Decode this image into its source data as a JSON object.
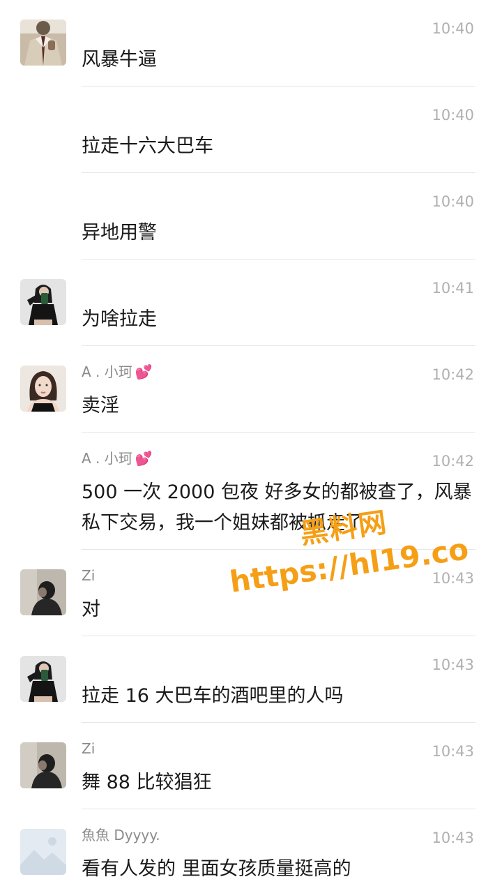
{
  "messages": [
    {
      "sender": "",
      "time": "10:40",
      "text": "风暴牛逼",
      "avatar": "man-suit"
    },
    {
      "sender": "",
      "time": "10:40",
      "text": "拉走十六大巴车",
      "avatar": ""
    },
    {
      "sender": "",
      "time": "10:40",
      "text": "异地用警",
      "avatar": ""
    },
    {
      "sender": "",
      "time": "10:41",
      "text": "为啥拉走",
      "avatar": "woman-phone"
    },
    {
      "sender": "A . 小珂",
      "time": "10:42",
      "text": "卖淫",
      "avatar": "woman-portrait"
    },
    {
      "sender": "A . 小珂",
      "time": "10:42",
      "text": "500 一次 2000 包夜 好多女的都被查了，风暴私下交易，我一个姐妹都被抓走了",
      "avatar": ""
    },
    {
      "sender": "Zi",
      "time": "10:43",
      "text": "对",
      "avatar": "dark-figure"
    },
    {
      "sender": "",
      "time": "10:43",
      "text": "拉走 16 大巴车的酒吧里的人吗",
      "avatar": "woman-phone"
    },
    {
      "sender": "Zi",
      "time": "10:43",
      "text": "舞 88 比较猖狂",
      "avatar": "dark-figure"
    },
    {
      "sender": "魚魚 Dyyyy.",
      "time": "10:43",
      "text": "看有人发的 里面女孩质量挺高的",
      "avatar": "placeholder-image"
    }
  ],
  "heart_emoji": "💕",
  "watermark": {
    "line1": "黑料网",
    "line2": "https://hl19.co"
  }
}
